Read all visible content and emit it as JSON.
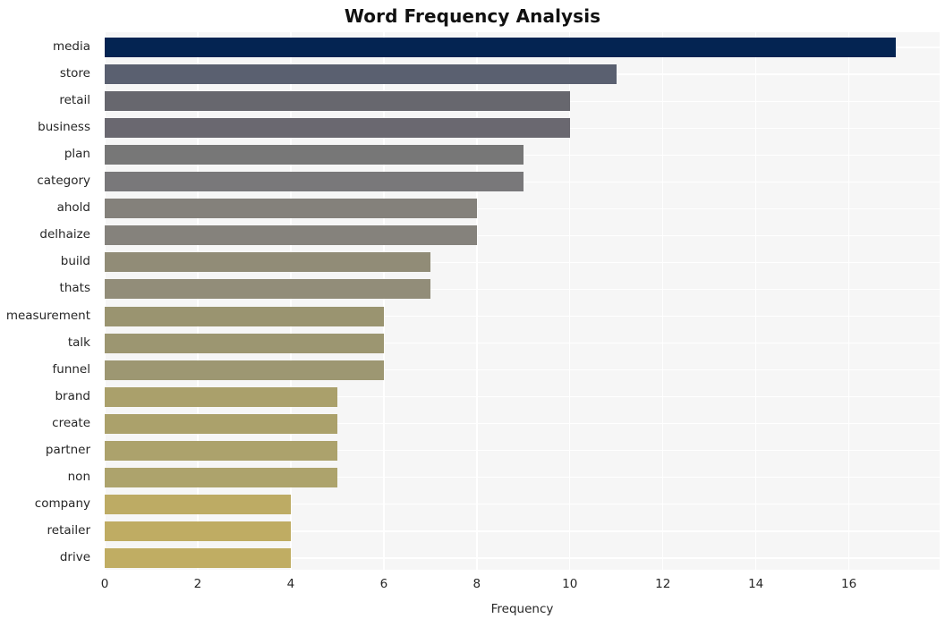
{
  "chart_data": {
    "type": "bar",
    "orientation": "horizontal",
    "title": "Word Frequency Analysis",
    "xlabel": "Frequency",
    "ylabel": "",
    "categories": [
      "media",
      "store",
      "retail",
      "business",
      "plan",
      "category",
      "ahold",
      "delhaize",
      "build",
      "thats",
      "measurement",
      "talk",
      "funnel",
      "brand",
      "create",
      "partner",
      "non",
      "company",
      "retailer",
      "drive"
    ],
    "values": [
      17,
      11,
      10,
      10,
      9,
      9,
      8,
      8,
      7,
      7,
      6,
      6,
      6,
      5,
      5,
      5,
      5,
      4,
      4,
      4
    ],
    "bar_colors": [
      "#042452",
      "#5a6070",
      "#67676e",
      "#6a6870",
      "#777777",
      "#79787a",
      "#84817b",
      "#85827c",
      "#918c77",
      "#928d79",
      "#9a9470",
      "#9c9671",
      "#9d9772",
      "#aaa06b",
      "#aba16b",
      "#aca26c",
      "#ada36c",
      "#bdab64",
      "#bfac63",
      "#c0ad63"
    ],
    "xticks": [
      "0",
      "2",
      "4",
      "6",
      "8",
      "10",
      "12",
      "14",
      "16"
    ],
    "xtick_values": [
      0,
      2,
      4,
      6,
      8,
      10,
      12,
      14,
      16
    ],
    "xlim": [
      0,
      17.95
    ],
    "grid": true,
    "legend": "none",
    "plot_background": "#f6f6f6",
    "grid_color": "#ffffff",
    "figure_background": "#ffffff"
  }
}
